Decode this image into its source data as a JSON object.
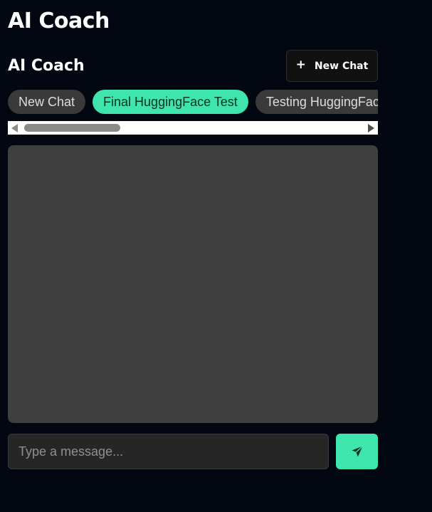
{
  "page": {
    "title": "AI Coach"
  },
  "coach": {
    "title": "AI Coach",
    "new_chat_label": "New Chat",
    "new_chat_icon": "plus-icon"
  },
  "tabs": [
    {
      "label": "New Chat",
      "active": false
    },
    {
      "label": "Final HuggingFace Test",
      "active": true
    },
    {
      "label": "Testing HuggingFace B",
      "active": false
    }
  ],
  "composer": {
    "placeholder": "Type a message...",
    "send_icon": "send-icon"
  },
  "colors": {
    "background": "#030712",
    "accent": "#3ee5ad",
    "panel": "#3f3f3f",
    "tab": "#3a3a3a"
  }
}
